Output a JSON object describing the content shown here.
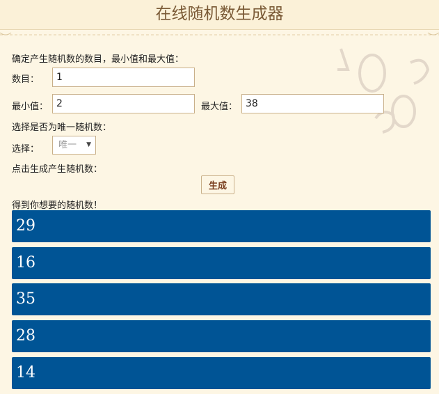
{
  "header": {
    "title": "在线随机数生成器"
  },
  "form": {
    "instruction": "确定产生随机数的数目，最小值和最大值：",
    "count_label": "数目：",
    "count_value": "1",
    "min_label": "最小值：",
    "min_value": "2",
    "max_label": "最大值：",
    "max_value": "38",
    "unique_prompt": "选择是否为唯一随机数：",
    "select_label": "选择：",
    "select_value": "唯一",
    "generate_prompt": "点击生成产生随机数：",
    "generate_label": "生成",
    "result_prompt": "得到你想要的随机数！"
  },
  "results": [
    "29",
    "16",
    "35",
    "28",
    "14"
  ],
  "colors": {
    "result_bg": "#005495",
    "header_text": "#7a5a36",
    "page_bg": "#fdf6e4"
  },
  "icons": {
    "select_arrow": "caret-down-icon"
  }
}
